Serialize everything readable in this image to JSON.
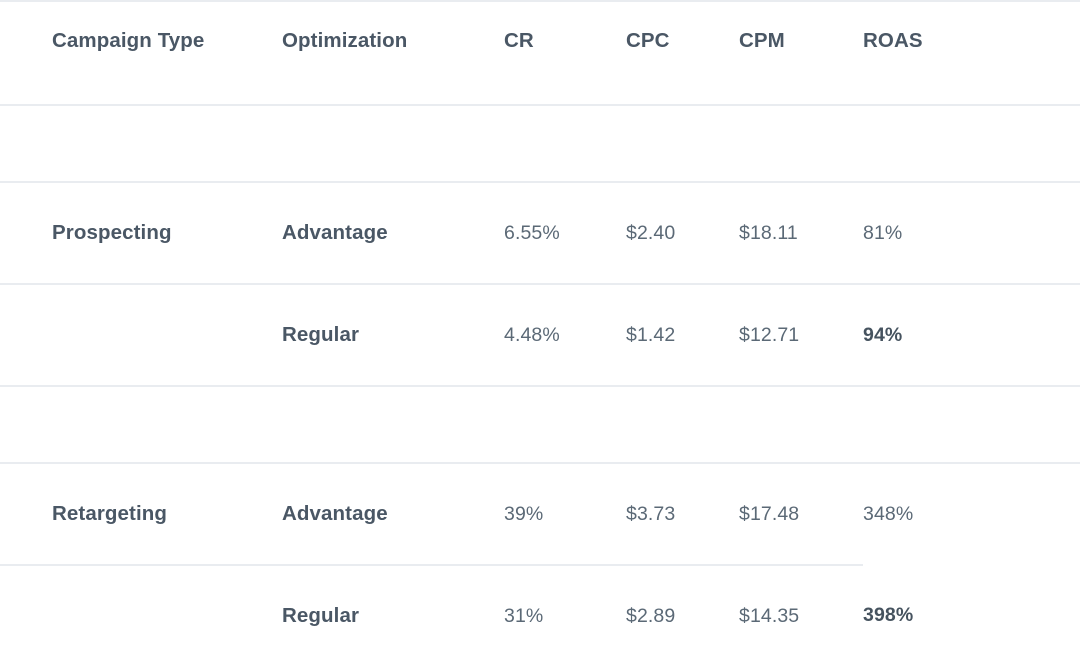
{
  "table": {
    "columns": [
      {
        "key": "campaign_type",
        "label": "Campaign Type",
        "align": "left"
      },
      {
        "key": "optimization",
        "label": "Optimization",
        "align": "left"
      },
      {
        "key": "cr",
        "label": "CR",
        "align": "left"
      },
      {
        "key": "cpc",
        "label": "CPC",
        "align": "left"
      },
      {
        "key": "cpm",
        "label": "CPM",
        "align": "left"
      },
      {
        "key": "roas",
        "label": "ROAS",
        "align": "left"
      }
    ],
    "groups": [
      {
        "campaign_type": "Prospecting",
        "rows": [
          {
            "campaign_type": "Prospecting",
            "optimization": "Advantage",
            "cr": "6.55%",
            "cpc": "$2.40",
            "cpm": "$18.11",
            "roas": "81%",
            "roas_highlighted": false
          },
          {
            "campaign_type": "",
            "optimization": "Regular",
            "cr": "4.48%",
            "cpc": "$1.42",
            "cpm": "$12.71",
            "roas": "94%",
            "roas_highlighted": true
          }
        ]
      },
      {
        "campaign_type": "Retargeting",
        "rows": [
          {
            "campaign_type": "Retargeting",
            "optimization": "Advantage",
            "cr": "39%",
            "cpc": "$3.73",
            "cpm": "$17.48",
            "roas": "348%",
            "roas_highlighted": false
          },
          {
            "campaign_type": "",
            "optimization": "Regular",
            "cr": "31%",
            "cpc": "$2.89",
            "cpm": "$14.35",
            "roas": "398%",
            "roas_highlighted": true
          }
        ]
      }
    ]
  },
  "colors": {
    "background": "#ffffff",
    "heading_text": "#4a5765",
    "metric_text": "#5b6976",
    "highlight_text": "#46535f",
    "rule": "#e9ecf0"
  }
}
